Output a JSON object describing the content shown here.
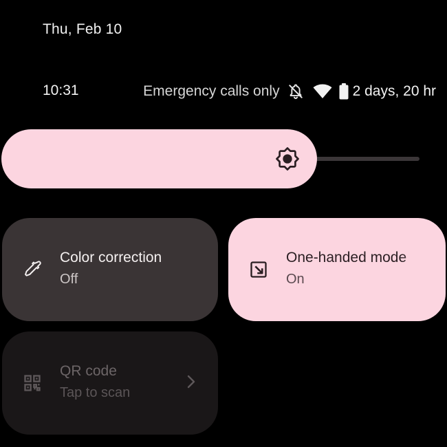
{
  "header": {
    "date": "Thu, Feb 10",
    "time": "10:31",
    "carrier_status": "Emergency calls only",
    "battery_text": "2 days, 20 hr"
  },
  "status_icons": [
    "notifications-off-icon",
    "wifi-icon",
    "battery-icon"
  ],
  "brightness": {
    "level": 0.74,
    "icon": "brightness-icon"
  },
  "tiles": [
    {
      "title": "Color correction",
      "subtitle": "Off",
      "icon": "eyedropper-icon",
      "state": "off"
    },
    {
      "title": "One-handed mode",
      "subtitle": "On",
      "icon": "one-handed-mode-icon",
      "state": "on"
    },
    {
      "title": "QR code",
      "subtitle": "Tap to scan",
      "icon": "qr-code-icon",
      "state": "unavailable"
    }
  ],
  "colors": {
    "background": "#000000",
    "accent_active": "#fcd5e0",
    "tile_inactive": "#3a3435",
    "tile_unavailable": "#1a1718"
  }
}
